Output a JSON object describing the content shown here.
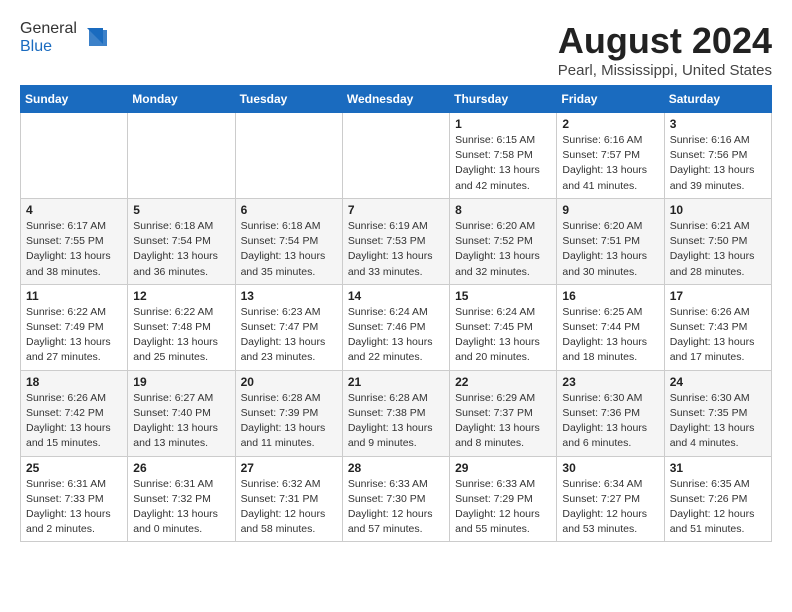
{
  "logo": {
    "general": "General",
    "blue": "Blue"
  },
  "header": {
    "month_year": "August 2024",
    "location": "Pearl, Mississippi, United States"
  },
  "days_of_week": [
    "Sunday",
    "Monday",
    "Tuesday",
    "Wednesday",
    "Thursday",
    "Friday",
    "Saturday"
  ],
  "weeks": [
    [
      {
        "day": "",
        "info": ""
      },
      {
        "day": "",
        "info": ""
      },
      {
        "day": "",
        "info": ""
      },
      {
        "day": "",
        "info": ""
      },
      {
        "day": "1",
        "info": "Sunrise: 6:15 AM\nSunset: 7:58 PM\nDaylight: 13 hours\nand 42 minutes."
      },
      {
        "day": "2",
        "info": "Sunrise: 6:16 AM\nSunset: 7:57 PM\nDaylight: 13 hours\nand 41 minutes."
      },
      {
        "day": "3",
        "info": "Sunrise: 6:16 AM\nSunset: 7:56 PM\nDaylight: 13 hours\nand 39 minutes."
      }
    ],
    [
      {
        "day": "4",
        "info": "Sunrise: 6:17 AM\nSunset: 7:55 PM\nDaylight: 13 hours\nand 38 minutes."
      },
      {
        "day": "5",
        "info": "Sunrise: 6:18 AM\nSunset: 7:54 PM\nDaylight: 13 hours\nand 36 minutes."
      },
      {
        "day": "6",
        "info": "Sunrise: 6:18 AM\nSunset: 7:54 PM\nDaylight: 13 hours\nand 35 minutes."
      },
      {
        "day": "7",
        "info": "Sunrise: 6:19 AM\nSunset: 7:53 PM\nDaylight: 13 hours\nand 33 minutes."
      },
      {
        "day": "8",
        "info": "Sunrise: 6:20 AM\nSunset: 7:52 PM\nDaylight: 13 hours\nand 32 minutes."
      },
      {
        "day": "9",
        "info": "Sunrise: 6:20 AM\nSunset: 7:51 PM\nDaylight: 13 hours\nand 30 minutes."
      },
      {
        "day": "10",
        "info": "Sunrise: 6:21 AM\nSunset: 7:50 PM\nDaylight: 13 hours\nand 28 minutes."
      }
    ],
    [
      {
        "day": "11",
        "info": "Sunrise: 6:22 AM\nSunset: 7:49 PM\nDaylight: 13 hours\nand 27 minutes."
      },
      {
        "day": "12",
        "info": "Sunrise: 6:22 AM\nSunset: 7:48 PM\nDaylight: 13 hours\nand 25 minutes."
      },
      {
        "day": "13",
        "info": "Sunrise: 6:23 AM\nSunset: 7:47 PM\nDaylight: 13 hours\nand 23 minutes."
      },
      {
        "day": "14",
        "info": "Sunrise: 6:24 AM\nSunset: 7:46 PM\nDaylight: 13 hours\nand 22 minutes."
      },
      {
        "day": "15",
        "info": "Sunrise: 6:24 AM\nSunset: 7:45 PM\nDaylight: 13 hours\nand 20 minutes."
      },
      {
        "day": "16",
        "info": "Sunrise: 6:25 AM\nSunset: 7:44 PM\nDaylight: 13 hours\nand 18 minutes."
      },
      {
        "day": "17",
        "info": "Sunrise: 6:26 AM\nSunset: 7:43 PM\nDaylight: 13 hours\nand 17 minutes."
      }
    ],
    [
      {
        "day": "18",
        "info": "Sunrise: 6:26 AM\nSunset: 7:42 PM\nDaylight: 13 hours\nand 15 minutes."
      },
      {
        "day": "19",
        "info": "Sunrise: 6:27 AM\nSunset: 7:40 PM\nDaylight: 13 hours\nand 13 minutes."
      },
      {
        "day": "20",
        "info": "Sunrise: 6:28 AM\nSunset: 7:39 PM\nDaylight: 13 hours\nand 11 minutes."
      },
      {
        "day": "21",
        "info": "Sunrise: 6:28 AM\nSunset: 7:38 PM\nDaylight: 13 hours\nand 9 minutes."
      },
      {
        "day": "22",
        "info": "Sunrise: 6:29 AM\nSunset: 7:37 PM\nDaylight: 13 hours\nand 8 minutes."
      },
      {
        "day": "23",
        "info": "Sunrise: 6:30 AM\nSunset: 7:36 PM\nDaylight: 13 hours\nand 6 minutes."
      },
      {
        "day": "24",
        "info": "Sunrise: 6:30 AM\nSunset: 7:35 PM\nDaylight: 13 hours\nand 4 minutes."
      }
    ],
    [
      {
        "day": "25",
        "info": "Sunrise: 6:31 AM\nSunset: 7:33 PM\nDaylight: 13 hours\nand 2 minutes."
      },
      {
        "day": "26",
        "info": "Sunrise: 6:31 AM\nSunset: 7:32 PM\nDaylight: 13 hours\nand 0 minutes."
      },
      {
        "day": "27",
        "info": "Sunrise: 6:32 AM\nSunset: 7:31 PM\nDaylight: 12 hours\nand 58 minutes."
      },
      {
        "day": "28",
        "info": "Sunrise: 6:33 AM\nSunset: 7:30 PM\nDaylight: 12 hours\nand 57 minutes."
      },
      {
        "day": "29",
        "info": "Sunrise: 6:33 AM\nSunset: 7:29 PM\nDaylight: 12 hours\nand 55 minutes."
      },
      {
        "day": "30",
        "info": "Sunrise: 6:34 AM\nSunset: 7:27 PM\nDaylight: 12 hours\nand 53 minutes."
      },
      {
        "day": "31",
        "info": "Sunrise: 6:35 AM\nSunset: 7:26 PM\nDaylight: 12 hours\nand 51 minutes."
      }
    ]
  ]
}
